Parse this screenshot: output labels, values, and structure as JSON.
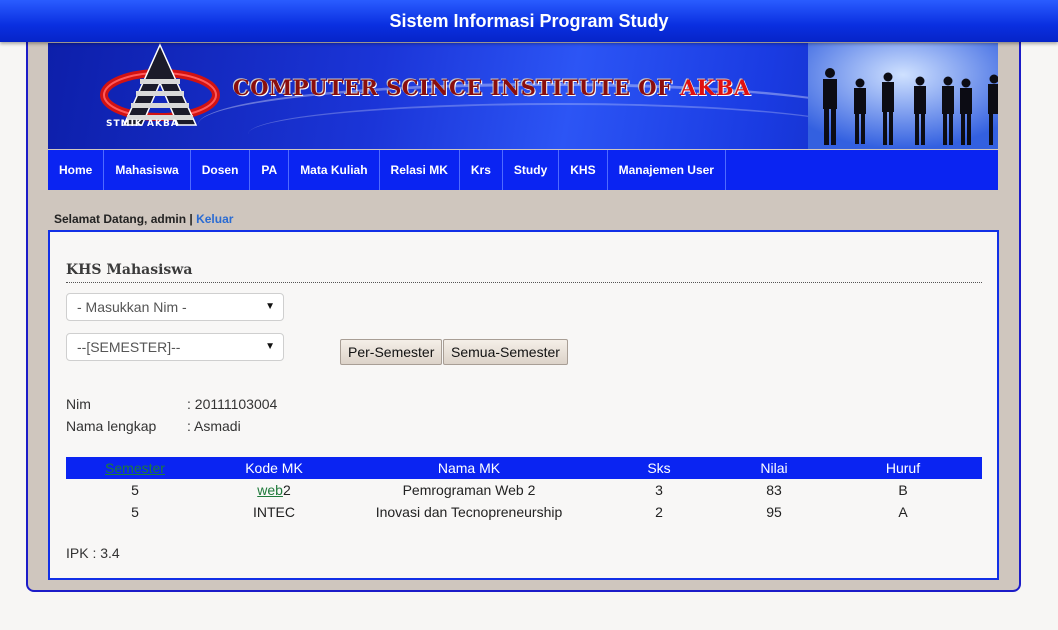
{
  "header": {
    "title": "Sistem Informasi Program Study"
  },
  "banner": {
    "title_main": "COMPUTER SCINCE INSTITUTE OF ",
    "title_accent": "AKBA",
    "logo_caption": "STMIK AKBA"
  },
  "nav": {
    "items": [
      "Home",
      "Mahasiswa",
      "Dosen",
      "PA",
      "Mata Kuliah",
      "Relasi MK",
      "Krs",
      "Study",
      "KHS",
      "Manajemen User"
    ]
  },
  "welcome": {
    "text": "Selamat Datang, admin | ",
    "logout": "Keluar"
  },
  "page": {
    "title": "KHS Mahasiswa"
  },
  "filters": {
    "nim_select": "- Masukkan Nim -",
    "semester_select": "--[SEMESTER]--",
    "btn_per_semester": "Per-Semester",
    "btn_semua_semester": "Semua-Semester"
  },
  "student": {
    "nim_label": "Nim",
    "nim_value": ": 20111103004",
    "name_label": "Nama lengkap",
    "name_value": ": Asmadi"
  },
  "table": {
    "headers": [
      "Semester",
      "Kode MK",
      "Nama MK",
      "Sks",
      "Nilai",
      "Huruf"
    ],
    "rows": [
      {
        "semester": "5",
        "kode_link": "web",
        "kode_rest": "2",
        "nama": "Pemrograman Web 2",
        "sks": "3",
        "nilai": "83",
        "huruf": "B"
      },
      {
        "semester": "5",
        "kode_link": "",
        "kode_rest": "INTEC",
        "nama": "Inovasi dan Tecnopreneurship",
        "sks": "2",
        "nilai": "95",
        "huruf": "A"
      }
    ]
  },
  "ipk": "IPK : 3.4",
  "colors": {
    "primary_blue": "#0a24f2",
    "frame": "#cfc6be",
    "accent_red": "#e01010"
  }
}
